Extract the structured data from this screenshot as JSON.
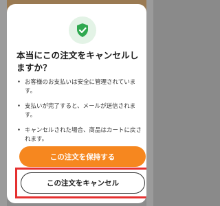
{
  "dialog": {
    "icon": "check-shield-icon",
    "title": "本当にこの注文をキャンセルしますか？",
    "points": [
      "お客様のお支払いは安全に管理されています。",
      "支払いが完了すると、メールが送信されます。",
      "キャンセルされた場合、商品はカートに戻されます。"
    ],
    "keep_button": "この注文を保持する",
    "cancel_button": "この注文をキャンセル"
  },
  "colors": {
    "accent": "#f6871f",
    "highlight": "#e53030",
    "badge_bg": "#e3f3e6",
    "badge_icon": "#2fa84f"
  }
}
